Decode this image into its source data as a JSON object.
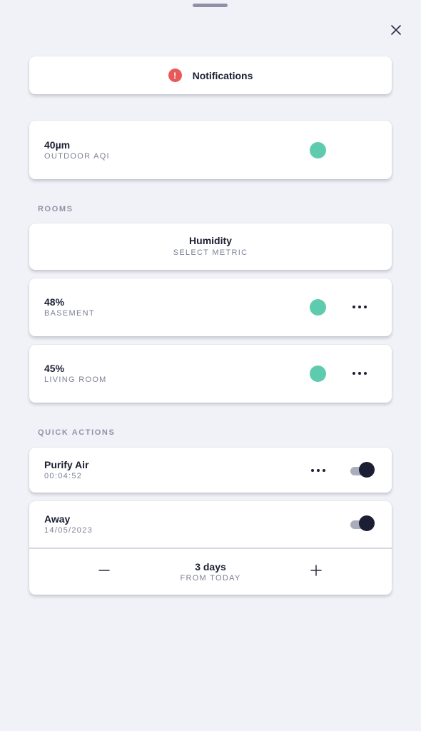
{
  "notifications": {
    "label": "Notifications",
    "alert_glyph": "!"
  },
  "outdoor": {
    "value": "40µm",
    "label": "OUTDOOR AQI",
    "status_color": "#5fcbae"
  },
  "rooms": {
    "section_label": "ROOMS",
    "metric_selector": {
      "value": "Humidity",
      "label": "SELECT METRIC"
    },
    "items": [
      {
        "value": "48%",
        "name": "BASEMENT",
        "status_color": "#5fcbae"
      },
      {
        "value": "45%",
        "name": "LIVING ROOM",
        "status_color": "#5fcbae"
      }
    ]
  },
  "quick_actions": {
    "section_label": "QUICK ACTIONS",
    "purify": {
      "title": "Purify Air",
      "detail": "00:04:52",
      "enabled": true
    },
    "away": {
      "title": "Away",
      "detail": "14/05/2023",
      "enabled": true,
      "duration": {
        "value": "3 days",
        "label": "FROM TODAY"
      }
    }
  },
  "icons": {
    "close": "close-icon",
    "more": "more-horizontal-icon",
    "minus": "minus-icon",
    "plus": "plus-icon",
    "alert": "alert-icon"
  },
  "colors": {
    "accent": "#5fcbae",
    "alert": "#e85a5a",
    "dark": "#1c1f33",
    "background": "#f1f2f7"
  }
}
